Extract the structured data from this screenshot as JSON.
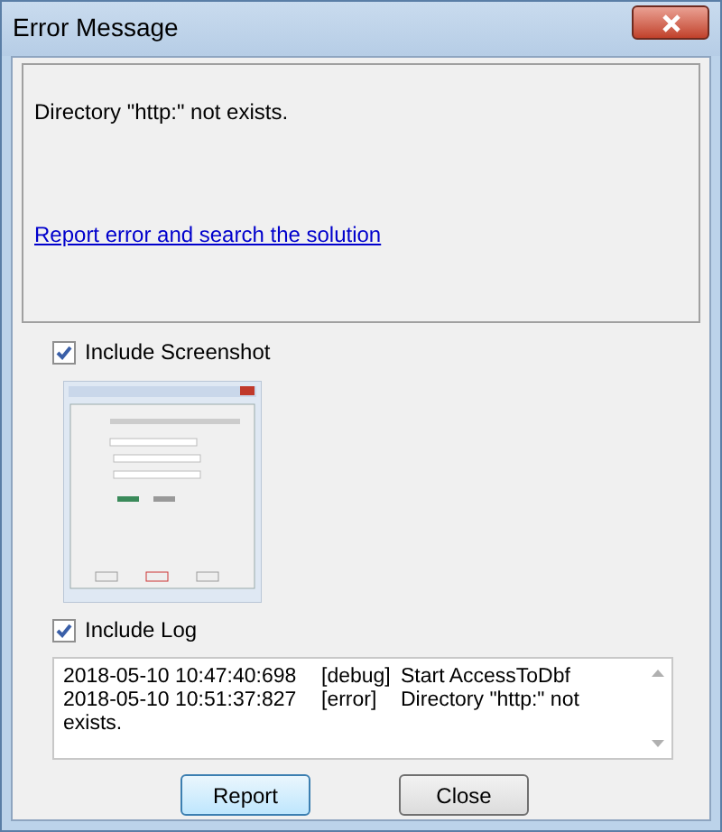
{
  "window": {
    "title": "Error Message"
  },
  "message": {
    "text": "Directory \"http:\" not exists.",
    "link": "Report error and search the solution"
  },
  "include_screenshot": {
    "label": "Include Screenshot",
    "checked": true
  },
  "include_log": {
    "label": "Include Log",
    "checked": true
  },
  "log": [
    {
      "time": "2018-05-10 10:47:40:698",
      "level": "[debug]",
      "message": "Start AccessToDbf"
    },
    {
      "time": "2018-05-10 10:51:37:827",
      "level": "[error]",
      "message": "Directory \"http:\" not exists."
    }
  ],
  "buttons": [
    {
      "label": "Report",
      "selected": true
    },
    {
      "label": "Close",
      "selected": false
    }
  ]
}
